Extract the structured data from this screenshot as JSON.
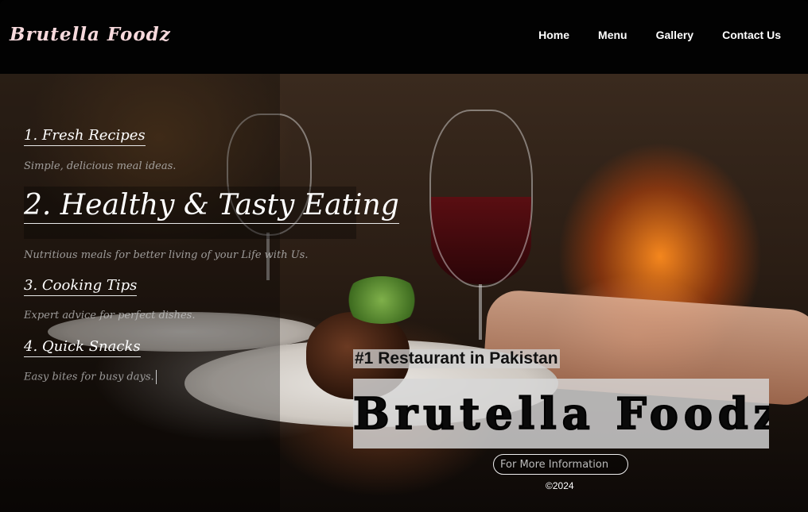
{
  "header": {
    "logo": "Brutella Foodz",
    "nav": [
      "Home",
      "Menu",
      "Gallery",
      "Contact Us"
    ]
  },
  "features": [
    {
      "title": "1. Fresh Recipes",
      "desc": "Simple, delicious meal ideas."
    },
    {
      "title": "2. Healthy & Tasty Eating",
      "desc": "Nutritious meals for better living of your Life with Us."
    },
    {
      "title": "3. Cooking Tips",
      "desc": "Expert advice for perfect dishes."
    },
    {
      "title": "4. Quick Snacks",
      "desc": "Easy bites for busy days."
    }
  ],
  "hero": {
    "tagline": "#1 Restaurant in Pakistan",
    "brand": "Brutella Foodz",
    "info_placeholder": "For More Information",
    "copyright": "©2024"
  }
}
